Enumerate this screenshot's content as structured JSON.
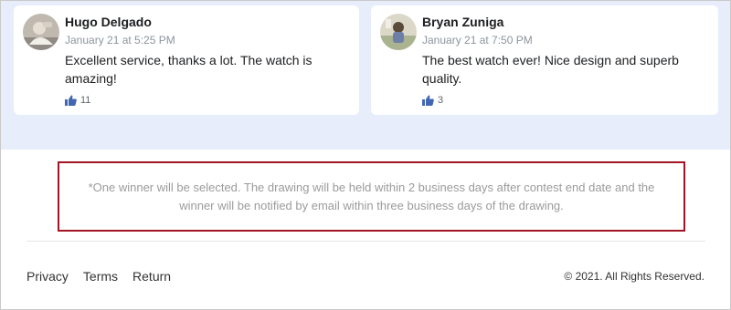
{
  "comments": [
    {
      "name": "Hugo Delgado",
      "date": "January 21 at 5:25 PM",
      "text": "Excellent service, thanks a lot. The watch is amazing!",
      "likes": "11"
    },
    {
      "name": "Bryan Zuniga",
      "date": "January 21 at 7:50 PM",
      "text": "The best watch ever! Nice design and superb quality.",
      "likes": "3"
    }
  ],
  "notice": {
    "text": "*One winner will be selected. The drawing will be held within 2 business days after contest end date and the winner will be notified by email within three business days of the drawing."
  },
  "footer": {
    "links": [
      "Privacy",
      "Terms",
      "Return"
    ],
    "copyright": "© 2021. All Rights Reserved."
  },
  "colors": {
    "band_background": "#e8edfb",
    "notice_border": "#a31424",
    "like_icon": "#4267b2"
  },
  "icons": {
    "like": "thumbs-up-icon"
  }
}
